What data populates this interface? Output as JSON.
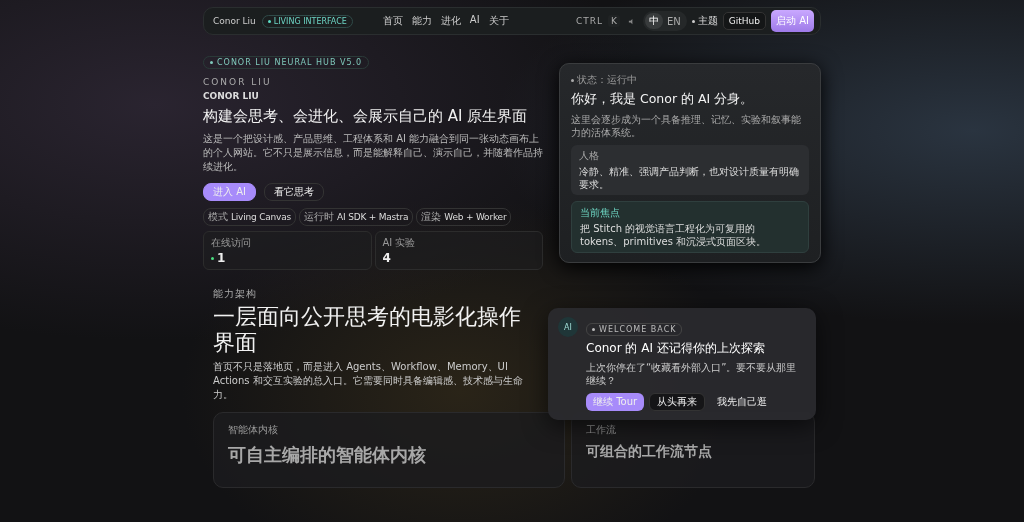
{
  "nav": {
    "brand": "Conor Liu",
    "badge": "LIVING INTERFACE",
    "links": [
      "首页",
      "能力",
      "进化",
      "AI",
      "关于"
    ],
    "shortcut": [
      "CTRL",
      "K"
    ],
    "languages": [
      {
        "label": "中",
        "selected": true
      },
      {
        "label": "EN",
        "selected": false
      }
    ],
    "theme": "主题",
    "github": "GitHub",
    "cta": "启动 AI"
  },
  "hero": {
    "tag": "CONOR LIU NEURAL HUB V5.0",
    "eyebrow": "CONOR LIU",
    "name": "CONOR LIU",
    "title": "构建会思考、会进化、会展示自己的 AI 原生界面",
    "description": "这是一个把设计感、产品思维、工程体系和 AI 能力融合到同一张动态画布上的个人网站。它不只是展示信息，而是能解释自己、演示自己，并随着作品持续进化。",
    "buttons": [
      {
        "label": "进入 AI",
        "kind": "primary"
      },
      {
        "label": "看它思考",
        "kind": "ghost"
      }
    ],
    "chips": [
      {
        "key": "模式",
        "value": "Living Canvas"
      },
      {
        "key": "运行时",
        "value": "AI SDK + Mastra"
      },
      {
        "key": "渲染",
        "value": "Web + Worker"
      }
    ],
    "stats": [
      {
        "label": "在线访问",
        "value": "1",
        "kind": "live"
      },
      {
        "label": "AI 实验",
        "value": "4",
        "kind": "plain"
      }
    ]
  },
  "agent_card": {
    "status": "状态：运行中",
    "title": "你好，我是 Conor 的 AI 分身。",
    "description": "这里会逐步成为一个具备推理、记忆、实验和叙事能力的活体系统。",
    "panels": [
      {
        "label": "人格",
        "text": "冷静、精准、强调产品判断，也对设计质量有明确要求。",
        "kind": "default"
      },
      {
        "label": "当前焦点",
        "text": "把 Stitch 的视觉语言工程化为可复用的 tokens、primitives 和沉浸式页面区块。",
        "kind": "focus"
      }
    ]
  },
  "section": {
    "eyebrow": "能力架构",
    "title": "一层面向公开思考的电影化操作界面",
    "description": "首页不只是落地页，而是进入 Agents、Workflow、Memory、UI Actions 和交互实验的总入口。它需要同时具备编辑感、技术感与生命力。",
    "cards": [
      {
        "label": "智能体内核",
        "title": "可自主编排的智能体内核"
      },
      {
        "label": "工作流",
        "title": "可组合的工作流节点"
      }
    ]
  },
  "welcome": {
    "avatar": "AI",
    "tag": "WELCOME BACK",
    "title": "Conor 的 AI 还记得你的上次探索",
    "text": "上次你停在了“收藏看外部入口”。要不要从那里继续？",
    "buttons": [
      {
        "label": "继续 Tour",
        "kind": "primary"
      },
      {
        "label": "从头再来",
        "kind": "dark"
      },
      {
        "label": "我先自己逛",
        "kind": "plain"
      }
    ]
  }
}
